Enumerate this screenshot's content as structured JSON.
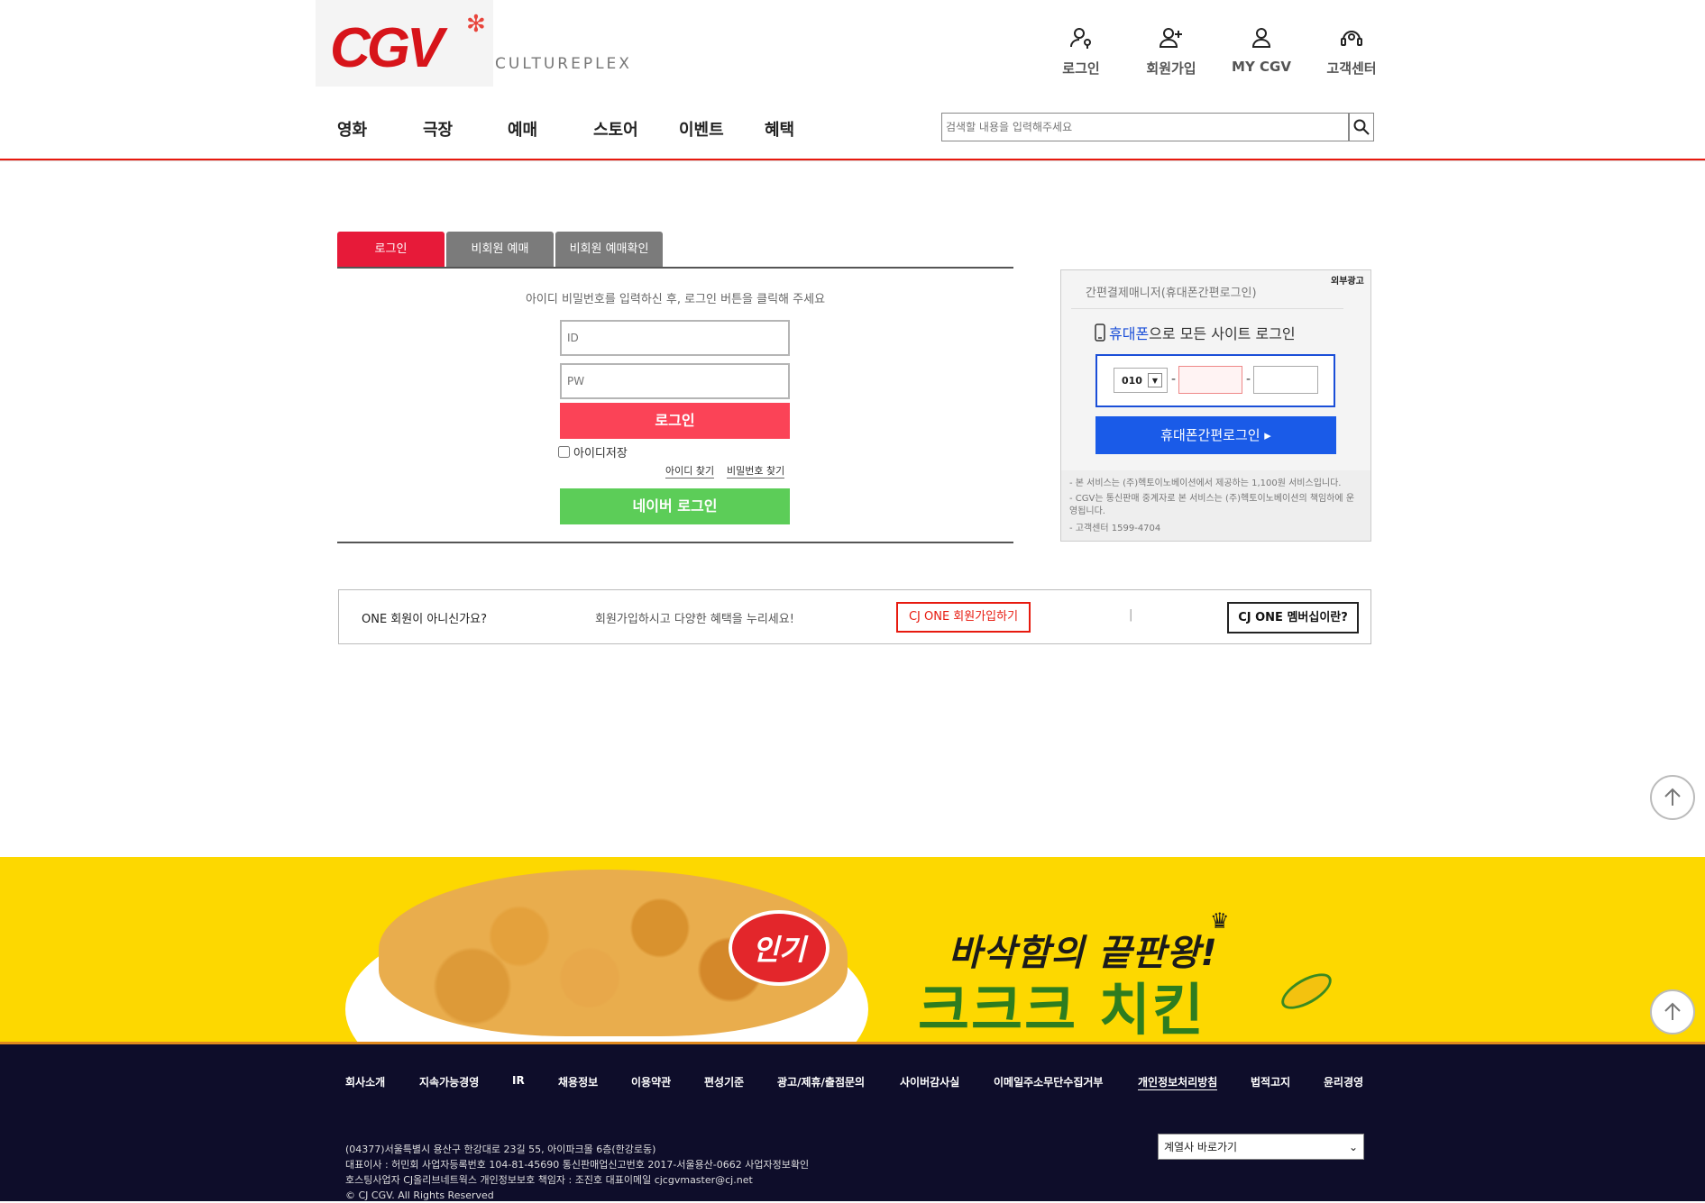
{
  "header": {
    "logo_text": "CGV",
    "cultureplex": "CULTUREPLEX",
    "top_links": [
      {
        "label": "로그인",
        "icon": "login-icon"
      },
      {
        "label": "회원가입",
        "icon": "signup-icon"
      },
      {
        "label": "MY CGV",
        "icon": "user-icon"
      },
      {
        "label": "고객센터",
        "icon": "headset-icon"
      }
    ],
    "nav": [
      "영화",
      "극장",
      "예매",
      "스토어",
      "이벤트",
      "혜택"
    ],
    "search_placeholder": "검색할 내용을 입력해주세요"
  },
  "login": {
    "tabs": [
      "로그인",
      "비회원 예매",
      "비회원 예매확인"
    ],
    "active_tab": 0,
    "instruction": "아이디 비밀번호를 입력하신 후, 로그인 버튼을 클릭해 주세요",
    "id_placeholder": "ID",
    "pw_placeholder": "PW",
    "login_button": "로그인",
    "save_id": "아이디저장",
    "find_id": "아이디 찾기",
    "find_pw": "비밀번호 찾기",
    "naver_button": "네이버 로그인"
  },
  "ad": {
    "label": "외부광고",
    "title": "간편결제매니저(휴대폰간편로그인)",
    "headline_blue": "휴대폰",
    "headline_rest": "으로 모든 사이트 로그인",
    "prefix": "010",
    "button": "휴대폰간편로그인 ▸",
    "notes": [
      "- 본 서비스는 (주)헥토이노베이션에서 제공하는 1,100원 서비스입니다.",
      "- CGV는 통신판매 중계자로 본 서비스는 (주)헥토이노베이션의 책임하에 운영됩니다.",
      "- 고객센터 1599-4704"
    ]
  },
  "one_banner": {
    "question": "ONE 회원이 아니신가요?",
    "description": "회원가입하시고 다양한 혜택을 누리세요!",
    "join_button": "CJ ONE 회원가입하기",
    "separator": "|",
    "what_button": "CJ ONE 멤버십이란?"
  },
  "promo": {
    "badge": "인기",
    "line1": "바삭함의 끝판왕!",
    "line2": "크크크 치킨"
  },
  "footer": {
    "links": [
      "회사소개",
      "지속가능경영",
      "IR",
      "채용정보",
      "이용약관",
      "편성기준",
      "광고/제휴/출점문의",
      "사이버감사실",
      "이메일주소무단수집거부",
      "개인정보처리방침",
      "법적고지",
      "윤리경영"
    ],
    "info": [
      "(04377)서울특별시 용산구 한강대로 23길 55, 아이파크몰 6층(한강로동)",
      "대표이사 : 허민회 사업자등록번호 104-81-45690 통신판매업신고번호 2017-서울용산-0662 사업자정보확인",
      "호스팅사업자 CJ올리브네트웍스 개인정보보호 책임자 : 조진호 대표이메일 cjcgvmaster@cj.net",
      "© CJ CGV. All Rights Reserved"
    ],
    "family_select": "계열사 바로가기"
  }
}
